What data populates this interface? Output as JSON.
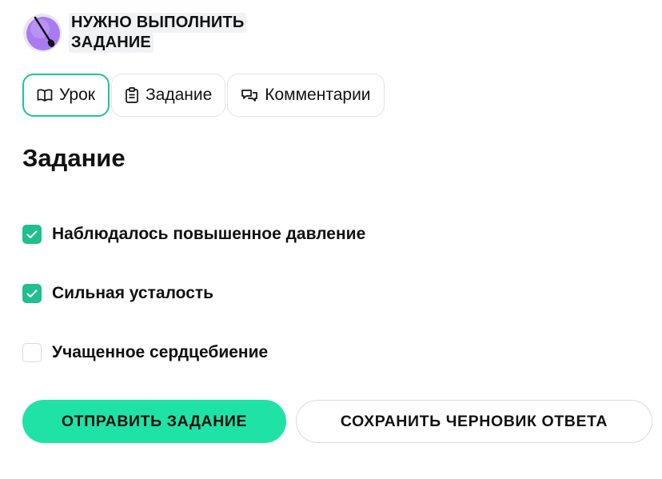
{
  "header": {
    "title_line1": "НУЖНО ВЫПОЛНИТЬ",
    "title_line2": "ЗАДАНИЕ",
    "logo_icon": "paintbrush-icon"
  },
  "tabs": [
    {
      "label": "Урок",
      "icon": "book-icon",
      "active": true
    },
    {
      "label": "Задание",
      "icon": "clipboard-icon",
      "active": false
    },
    {
      "label": "Комментарии",
      "icon": "comments-icon",
      "active": false
    }
  ],
  "section": {
    "title": "Задание"
  },
  "options": [
    {
      "label": "Наблюдалось повышенное давление",
      "checked": true
    },
    {
      "label": "Сильная усталость",
      "checked": true
    },
    {
      "label": "Учащенное сердцебиение",
      "checked": false
    }
  ],
  "actions": {
    "submit_label": "ОТПРАВИТЬ ЗАДАНИЕ",
    "save_draft_label": "СОХРАНИТЬ ЧЕРНОВИК ОТВЕТА"
  },
  "colors": {
    "accent": "#1fc596",
    "checkbox": "#1fbf8f",
    "primary_button": "#1fe3a6",
    "logo_purple": "#a97bf0"
  }
}
